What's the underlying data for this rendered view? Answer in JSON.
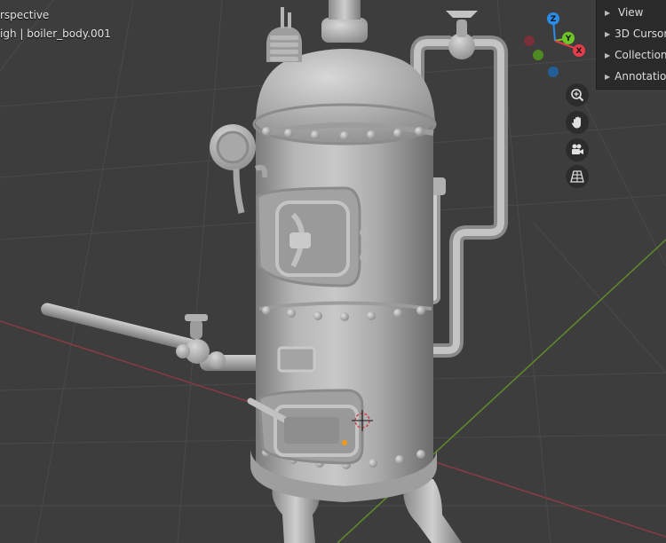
{
  "viewport": {
    "view_label": "rspective",
    "object_label": "igh | boiler_body.001"
  },
  "nav_gizmo": {
    "z_label": "Z",
    "y_label": "Y",
    "x_label": "X",
    "colors": {
      "x": "#e63c4b",
      "y": "#6ec728",
      "z": "#2a8ce6"
    }
  },
  "viewport_tools": [
    {
      "name": "zoom-icon"
    },
    {
      "name": "hand-pan-icon"
    },
    {
      "name": "camera-icon"
    },
    {
      "name": "grid-perspective-icon"
    }
  ],
  "sidebar": {
    "items": [
      {
        "label": "View"
      },
      {
        "label": "3D Cursor"
      },
      {
        "label": "Collection"
      },
      {
        "label": "Annotation"
      }
    ]
  },
  "scene": {
    "object": "boiler_body.001",
    "material_color": "#b4b4b4",
    "floor_grid": "on"
  }
}
